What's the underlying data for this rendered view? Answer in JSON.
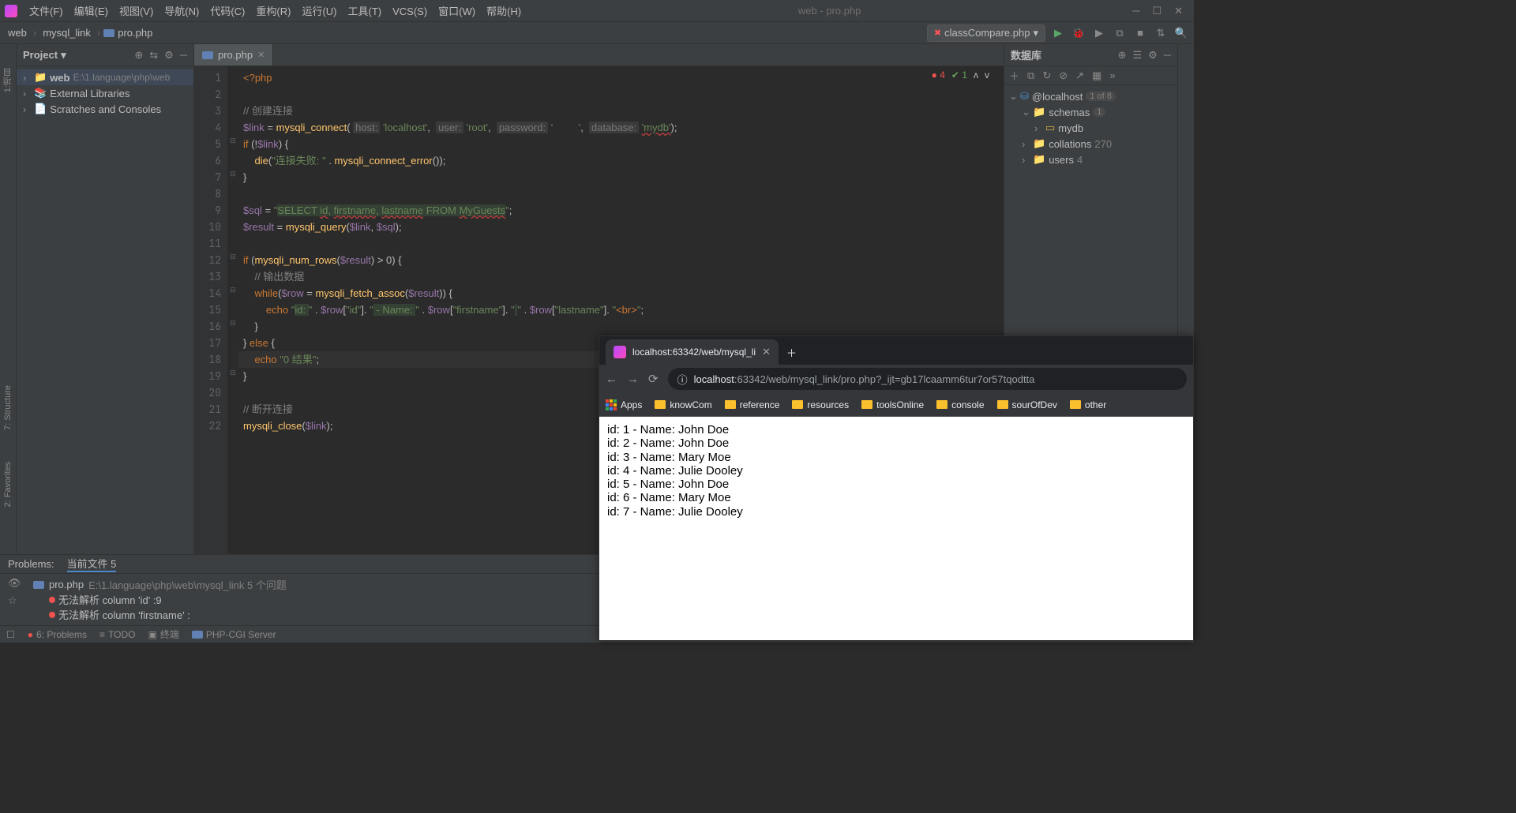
{
  "window_title": "web - pro.php",
  "menus": [
    "文件(F)",
    "编辑(E)",
    "视图(V)",
    "导航(N)",
    "代码(C)",
    "重构(R)",
    "运行(U)",
    "工具(T)",
    "VCS(S)",
    "窗口(W)",
    "帮助(H)"
  ],
  "breadcrumbs": [
    "web",
    "mysql_link",
    "pro.php"
  ],
  "run_config": "classCompare.php",
  "left_strip": [
    "1:项目",
    "7: Structure",
    "2: Favorites"
  ],
  "project_panel_title": "Project",
  "tree": {
    "root": {
      "name": "web",
      "path": "E:\\1.language\\php\\web"
    },
    "items": [
      "External Libraries",
      "Scratches and Consoles"
    ]
  },
  "editor_tab": "pro.php",
  "editor_status": {
    "errors": "4",
    "warnings": "1"
  },
  "code_lines": [
    {
      "n": 1,
      "html": "<span class='orange'>&lt;?php</span>"
    },
    {
      "n": 2,
      "html": ""
    },
    {
      "n": 3,
      "html": "<span class='grey'>// 创建连接</span>"
    },
    {
      "n": 4,
      "html": "<span class='purple'>$link</span> = <span class='yellow'>mysqli_connect</span>( <span class='hint'>host:</span> <span class='green'>'localhost'</span>,  <span class='hint'>user:</span> <span class='green'>'root'</span>,  <span class='hint'>password:</span> <span class='green'>'         '</span>,  <span class='hint'>database:</span> <span class='green err'>'mydb'</span>);"
    },
    {
      "n": 5,
      "html": "<span class='orange'>if</span> (!<span class='purple'>$link</span>) {"
    },
    {
      "n": 6,
      "html": "    <span class='yellow'>die</span>(<span class='green'>\"连接失败: \"</span> . <span class='yellow'>mysqli_connect_error</span>());"
    },
    {
      "n": 7,
      "html": "}"
    },
    {
      "n": 8,
      "html": ""
    },
    {
      "n": 9,
      "html": "<span class='purple'>$sql</span> = <span class='green'>\"<span class='hl'>SELECT <span class='err'>id</span>, <span class='err'>firstname</span>, <span class='err'>lastname</span> FROM <span class='err'>MyGuests</span></span>\"</span>;"
    },
    {
      "n": 10,
      "html": "<span class='purple'>$result</span> = <span class='yellow'>mysqli_query</span>(<span class='purple'>$link</span>, <span class='purple'>$sql</span>);"
    },
    {
      "n": 11,
      "html": ""
    },
    {
      "n": 12,
      "html": "<span class='orange'>if</span> (<span class='yellow'>mysqli_num_rows</span>(<span class='purple'>$result</span>) &gt; <span>0</span>) {"
    },
    {
      "n": 13,
      "html": "    <span class='grey'>// 输出数据</span>"
    },
    {
      "n": 14,
      "html": "    <span class='orange'>while</span>(<span class='purple'>$row</span> = <span class='yellow'>mysqli_fetch_assoc</span>(<span class='purple'>$result</span>)) {"
    },
    {
      "n": 15,
      "html": "        <span class='orange'>echo</span> <span class='green'>\"<span class='hl'>id: </span>\"</span> . <span class='purple'>$row</span>[<span class='green'>\"id\"</span>]. <span class='green'>\"<span class='hl'> - Name: </span>\"</span> . <span class='purple'>$row</span>[<span class='green'>\"firstname\"</span>]. <span class='green'>\"<span class='hl'> </span>\"</span> . <span class='purple'>$row</span>[<span class='green'>\"lastname\"</span>]. <span class='green'>\"</span><span class='orange'>&lt;br&gt;</span><span class='green'>\"</span>;"
    },
    {
      "n": 16,
      "html": "    }"
    },
    {
      "n": 17,
      "html": "} <span class='orange'>else</span> {"
    },
    {
      "n": 18,
      "html": "    <span class='orange'>echo</span> <span class='green'>\"0 结果\"</span>;",
      "sel": true
    },
    {
      "n": 19,
      "html": "}"
    },
    {
      "n": 20,
      "html": ""
    },
    {
      "n": 21,
      "html": "<span class='grey'>// 断开连接</span>"
    },
    {
      "n": 22,
      "html": "<span class='yellow'>mysqli_close</span>(<span class='purple'>$link</span>);"
    }
  ],
  "db_panel_title": "数据库",
  "db_tree": {
    "host": "@localhost",
    "host_count": "1 of 8",
    "schemas_label": "schemas",
    "schemas_count": "1",
    "db": "mydb",
    "collations_label": "collations",
    "collations_count": "270",
    "users_label": "users",
    "users_count": "4"
  },
  "problems": {
    "label": "Problems:",
    "tabs": [
      "当前文件 5"
    ],
    "file": "pro.php",
    "file_path": "E:\\1.language\\php\\web\\mysql_link  5 个问题",
    "items": [
      "无法解析 column 'id' :9",
      "无法解析 column 'firstname' :"
    ]
  },
  "status_bar": [
    "6: Problems",
    "TODO",
    "终端",
    "PHP-CGI Server"
  ],
  "browser": {
    "tab_title": "localhost:63342/web/mysql_li",
    "url_host": "localhost",
    "url_rest": ":63342/web/mysql_link/pro.php?_ijt=gb17lcaamm6tur7or57tqodtta",
    "bookmarks": [
      "Apps",
      "knowCom",
      "reference",
      "resources",
      "toolsOnline",
      "console",
      "sourOfDev",
      "other"
    ],
    "content": [
      "id: 1 - Name: John Doe",
      "id: 2 - Name: John Doe",
      "id: 3 - Name: Mary Moe",
      "id: 4 - Name: Julie Dooley",
      "id: 5 - Name: John Doe",
      "id: 6 - Name: Mary Moe",
      "id: 7 - Name: Julie Dooley"
    ]
  }
}
